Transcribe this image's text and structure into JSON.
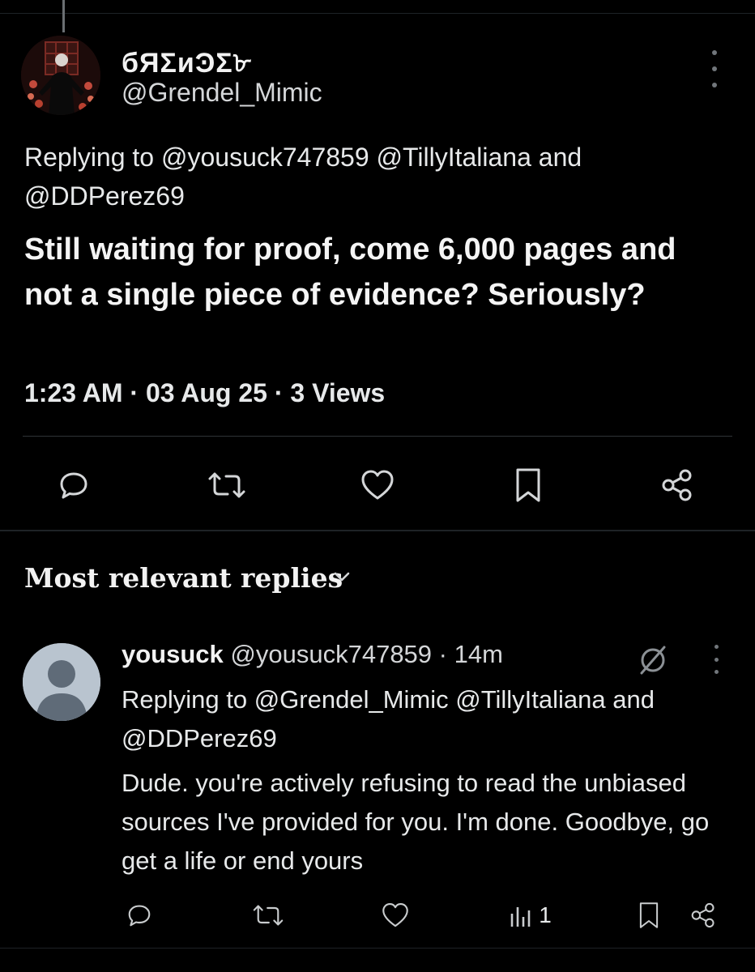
{
  "tweet": {
    "display_name": "бЯΣиϿΣ৮",
    "handle": "@Grendel_Mimic",
    "replying_to": "Replying to @yousuck747859 @TillyItaliana and @DDPerez69",
    "text": "Still waiting for proof, come 6,000 pages and not a single piece of evidence? Seriously?",
    "meta": "1:23 AM · 03 Aug 25 · 3 Views"
  },
  "icons": {
    "reply": "reply-icon",
    "retweet": "retweet-icon",
    "like": "heart-icon",
    "bookmark": "bookmark-icon",
    "share": "share-icon",
    "views": "views-icon",
    "grok": "grok-icon",
    "more": "more-icon"
  },
  "replies_section": {
    "title": "Most relevant replies"
  },
  "reply": {
    "name": "yousuck",
    "handle_time": "@yousuck747859 · 14m",
    "replying_to": "Replying to @Grendel_Mimic @TillyItaliana and @DDPerez69",
    "text": "Dude. you're actively refusing to read the unbiased sources I've provided for you. I'm done. Goodbye, go get a life or end yours",
    "views": "1"
  },
  "colors": {
    "background": "#000000",
    "text": "#e7e9ea",
    "muted": "#71767b",
    "divider": "#2f3336",
    "default_avatar": "#b9c4cf"
  }
}
